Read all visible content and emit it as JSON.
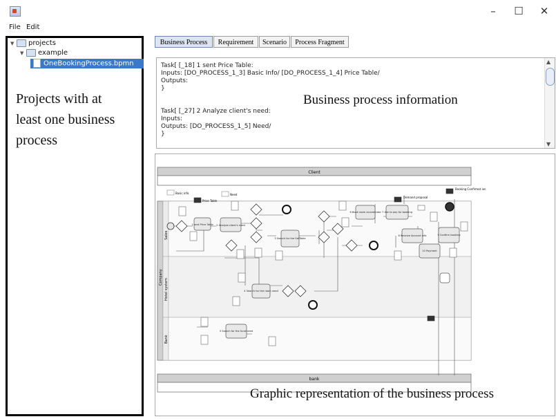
{
  "menu": {
    "file": "File",
    "edit": "Edit"
  },
  "tree": {
    "root": "projects",
    "child": "example",
    "file": "OneBookingProcess.bpmn"
  },
  "annotations": {
    "left": [
      "Projects with at",
      "least one business",
      "process"
    ],
    "info": "Business  process information",
    "graphic": "Graphic representation of the business process"
  },
  "tabs": [
    "Business Process",
    "Requirement",
    "Scenario",
    "Process Fragment"
  ],
  "info_lines": [
    "Task[ [_18] 1 sent Price  Table:",
    " Inputs: [DO_PROCESS_1_3] Basic Info/ [DO_PROCESS_1_4] Price Table/",
    " Outputs:",
    "}",
    "",
    "Task[ [_27]  2 Analyze client's need:",
    " Inputs:",
    " Outputs: [DO_PROCESS_1_5] Need/",
    "}"
  ],
  "bpmn": {
    "pool_client": "Client",
    "pool_bank": "bank",
    "pool_company": "Company",
    "msg_basic_info": "Basic info",
    "msg_price_table": "Price Table",
    "msg_need": "Need",
    "msg_demand_proposal": "Demand proposal",
    "msg_booking_confirm": "Booking Confirmat ion",
    "task_send_price": "1 sent Price Table",
    "task_analyze": "2 Analyze client's need",
    "task_search_table": "3 Search for the SetTable",
    "task_search_room": "4 Search for the room need",
    "task_search_bank": "5 Search for the fund need",
    "task_book_room": "6 Book room accordinate",
    "task_ask_pay": "7 Ask to pay for booking",
    "task_receive_account": "8 Receive Account info",
    "task_confirm": "9 Confirm booking",
    "task_payment": "10 Payment",
    "lane_sales": "Sales",
    "lane_hotel": "Hotel system",
    "lane_bank": "Bank"
  },
  "colors": {
    "selection": "#3a78c9",
    "tab_active": "#dbe4ef",
    "pool_header": "#d0d0d0"
  }
}
